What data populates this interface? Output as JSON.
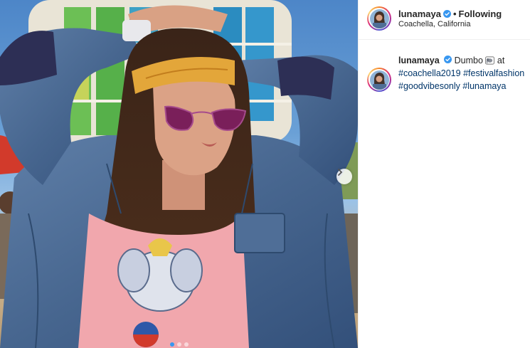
{
  "post": {
    "username": "lunamaya",
    "follow_state": "Following",
    "separator": "•",
    "location": "Coachella, California",
    "caption_text": "Dumbo",
    "caption_emoji": "elephant-emoji",
    "caption_word": "at",
    "hashtags": [
      "#coachella2019",
      "#festivalfashion",
      "#goodvibesonly",
      "#lunamaya"
    ]
  },
  "carousel": {
    "slide_count": 3,
    "active_slide": 1,
    "next_icon": "chevron-right-icon"
  },
  "colors": {
    "hashtag": "#003569",
    "carousel_active_dot": "#3897f0",
    "verified_badge": "#3897f0"
  }
}
